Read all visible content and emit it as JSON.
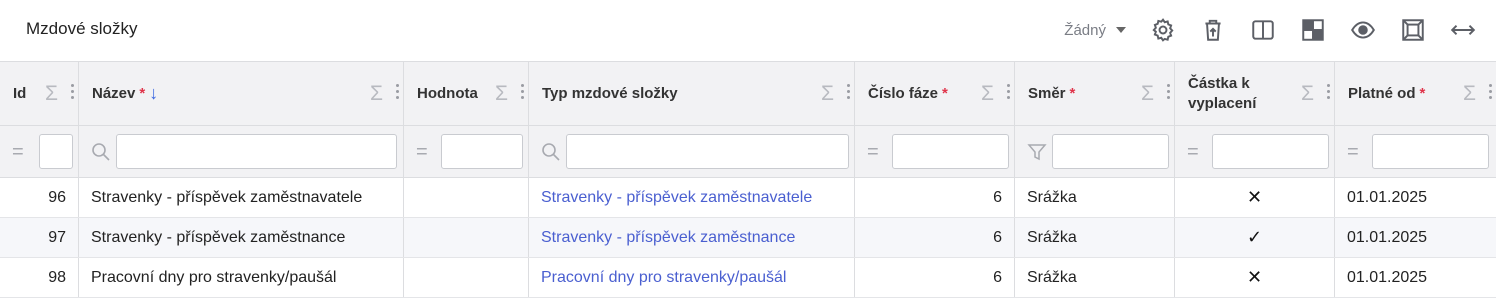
{
  "title": "Mzdové složky",
  "toolbar": {
    "view_select": "Žádný",
    "icons": [
      "gear-icon",
      "delete-icon",
      "columns-icon",
      "layout-icon",
      "eye-icon",
      "fit-icon",
      "expand-width-icon"
    ]
  },
  "columns": [
    {
      "label": "Id",
      "required": false
    },
    {
      "label": "Název",
      "required": true,
      "sorted": "desc"
    },
    {
      "label": "Hodnota",
      "required": false
    },
    {
      "label": "Typ mzdové složky",
      "required": false
    },
    {
      "label": "Číslo fáze",
      "required": true
    },
    {
      "label": "Směr",
      "required": true
    },
    {
      "label": "Částka k vyplacení",
      "required": false
    },
    {
      "label": "Platné od",
      "required": true
    }
  ],
  "header": {
    "req_mark": "*",
    "sigma": "Σ",
    "sort_arrow": "↓",
    "c7_line1": "Částka k",
    "c7_line2": "vyplacení"
  },
  "filters": {
    "equals_symbol": "=",
    "search_symbol": "⚲",
    "filter_symbol": "▽"
  },
  "rows": [
    {
      "id": "96",
      "name": "Stravenky - příspěvek zaměstnavatele",
      "value": "",
      "type": "Stravenky - příspěvek zaměstnavatele",
      "phase": "6",
      "direction": "Srážka",
      "payout": "✕",
      "valid_from": "01.01.2025"
    },
    {
      "id": "97",
      "name": "Stravenky - příspěvek zaměstnance",
      "value": "",
      "type": "Stravenky - příspěvek zaměstnance",
      "phase": "6",
      "direction": "Srážka",
      "payout": "✓",
      "valid_from": "01.01.2025"
    },
    {
      "id": "98",
      "name": "Pracovní dny pro stravenky/paušál",
      "value": "",
      "type": "Pracovní dny pro stravenky/paušál",
      "phase": "6",
      "direction": "Srážka",
      "payout": "✕",
      "valid_from": "01.01.2025"
    }
  ],
  "colors": {
    "link": "#4a5fd0",
    "required": "#e0344a",
    "sort": "#3b67e0"
  }
}
